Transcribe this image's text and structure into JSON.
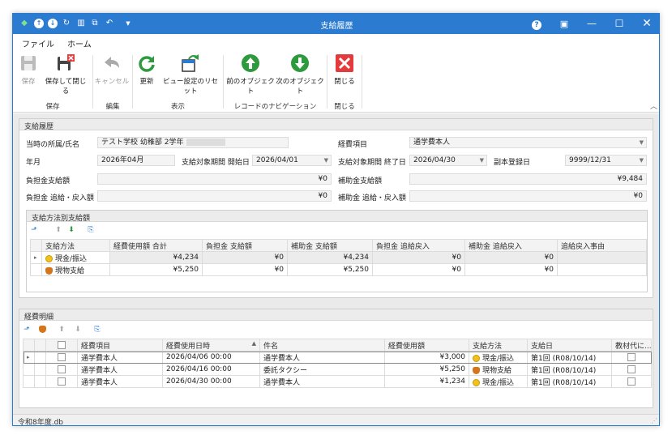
{
  "window": {
    "title": "支給履歴"
  },
  "menu": {
    "file": "ファイル",
    "home": "ホーム"
  },
  "ribbon": {
    "save": "保存",
    "save_close": "保存して閉じる",
    "cancel": "キャンセル",
    "refresh": "更新",
    "reset_view": "ビュー設定のリセット",
    "prev": "前のオブジェクト",
    "next": "次のオブジェクト",
    "close": "閉じる",
    "groups": {
      "save": "保存",
      "edit": "編集",
      "display": "表示",
      "nav": "レコードのナビゲーション",
      "close": "閉じる"
    }
  },
  "form": {
    "section": "支給履歴",
    "affiliation_label": "当時の所属/氏名",
    "affiliation_value": "テスト学校 幼稚部 2学年",
    "expense_item_label": "経費項目",
    "expense_item_value": "通学費本人",
    "year_month_label": "年月",
    "year_month_value": "2026年04月",
    "period_start_label": "支給対象期間 開始日",
    "period_start_value": "2026/04/01",
    "period_end_label": "支給対象期間 終了日",
    "period_end_value": "2026/04/30",
    "sub_date_label": "副本登録日",
    "sub_date_value": "9999/12/31",
    "burden_label": "負担金支給額",
    "burden_value": "¥0",
    "subsidy_label": "補助金支給額",
    "subsidy_value": "¥9,484",
    "burden_refund_label": "負担金 追給・戻入額",
    "burden_refund_value": "¥0",
    "subsidy_refund_label": "補助金 追給・戻入額",
    "subsidy_refund_value": "¥0"
  },
  "method": {
    "section": "支給方法別支給額",
    "headers": [
      "支給方法",
      "経費使用額 合計",
      "負担金 支給額",
      "補助金 支給額",
      "負担金 追給戻入",
      "補助金 追給戻入",
      "追給戻入事由"
    ],
    "rows": [
      {
        "method": "現金/振込",
        "total": "¥4,234",
        "burden": "¥0",
        "subsidy": "¥4,234",
        "burden_ref": "¥0",
        "subsidy_ref": "¥0",
        "reason": ""
      },
      {
        "method": "現物支給",
        "total": "¥5,250",
        "burden": "¥0",
        "subsidy": "¥5,250",
        "burden_ref": "¥0",
        "subsidy_ref": "¥0",
        "reason": ""
      }
    ]
  },
  "detail": {
    "section": "経費明細",
    "headers": [
      "経費項目",
      "経費使用日時",
      "件名",
      "経費使用額",
      "支給方法",
      "支給日",
      "教材代に..."
    ],
    "rows": [
      {
        "item": "通学費本人",
        "datetime": "2026/04/06 00:00",
        "subject": "通学費本人",
        "amount": "¥3,000",
        "method": "現金/振込",
        "pay": "第1回 (R08/10/14)"
      },
      {
        "item": "通学費本人",
        "datetime": "2026/04/16 00:00",
        "subject": "委託タクシー",
        "amount": "¥5,250",
        "method": "現物支給",
        "pay": "第1回 (R08/10/14)"
      },
      {
        "item": "通学費本人",
        "datetime": "2026/04/30 00:00",
        "subject": "通学費本人",
        "amount": "¥1,234",
        "method": "現金/振込",
        "pay": "第1回 (R08/10/14)"
      }
    ]
  },
  "status": {
    "file": "令和8年度.db"
  },
  "colors": {
    "accent": "#2b7bd0",
    "green": "#2e9a3e",
    "red": "#e33b3b"
  }
}
